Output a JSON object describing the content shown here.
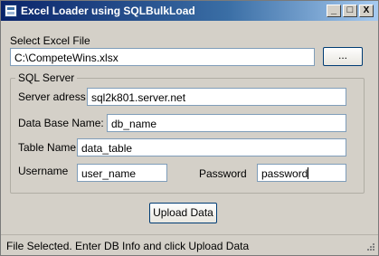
{
  "window": {
    "title": "Excel Loader using SQLBulkLoad",
    "minimize_label": "_",
    "maximize_label": "□",
    "close_label": "X"
  },
  "excel": {
    "label": "Select Excel File",
    "path": "C:\\CompeteWins.xlsx",
    "browse_label": "..."
  },
  "sql": {
    "group_label": "SQL Server",
    "server_label": "Server adress",
    "server_value": "sql2k801.server.net",
    "db_label": "Data Base Name:",
    "db_value": "db_name",
    "table_label": "Table Name",
    "table_value": "data_table",
    "user_label": "Username",
    "user_value": "user_name",
    "password_label": "Password",
    "password_value": "password"
  },
  "upload_label": "Upload Data",
  "status_text": "File Selected. Enter DB Info and click Upload Data"
}
